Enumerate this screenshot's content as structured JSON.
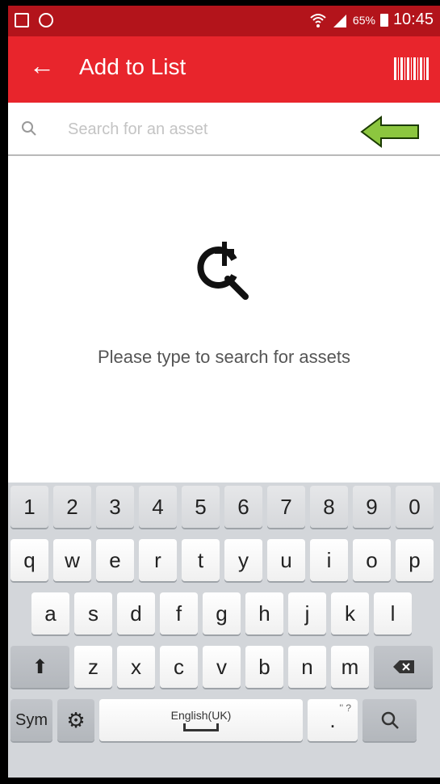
{
  "status_bar": {
    "battery_percent": "65%",
    "time": "10:45"
  },
  "app_bar": {
    "title": "Add to List",
    "back_icon": "arrow-left-icon",
    "action_icon": "barcode-icon"
  },
  "search": {
    "placeholder": "Search for an asset",
    "value": ""
  },
  "empty_state": {
    "icon": "search-add-icon",
    "message": "Please type to search for assets"
  },
  "keyboard": {
    "number_row": [
      "1",
      "2",
      "3",
      "4",
      "5",
      "6",
      "7",
      "8",
      "9",
      "0"
    ],
    "row1": [
      "q",
      "w",
      "e",
      "r",
      "t",
      "y",
      "u",
      "i",
      "o",
      "p"
    ],
    "row2": [
      "a",
      "s",
      "d",
      "f",
      "g",
      "h",
      "j",
      "k",
      "l"
    ],
    "row3": [
      "z",
      "x",
      "c",
      "v",
      "b",
      "n",
      "m"
    ],
    "sym_label": "Sym",
    "space_label": "English(UK)",
    "period_label": ".",
    "period_sup": "'' ?"
  },
  "colors": {
    "status_bar": "#b3141b",
    "app_bar": "#e8252c",
    "annotation_arrow": "#8cc63f"
  }
}
